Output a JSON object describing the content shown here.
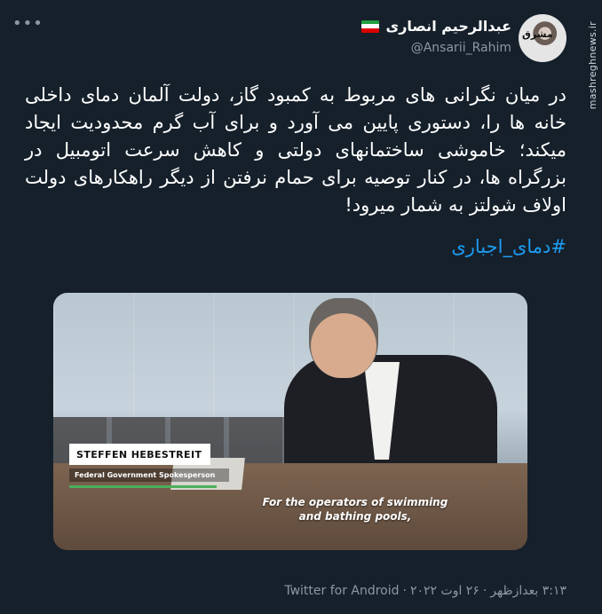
{
  "watermark": "mashreghnews.ir",
  "author": {
    "display_name": "عبدالرحیم انصاری",
    "handle": "@Ansarii_Rahim",
    "avatar_mark": "مشرق",
    "flag_colors": [
      "#239f40",
      "#ffffff",
      "#da0000"
    ]
  },
  "tweet": {
    "text": "در میان نگرانی های مربوط به کمبود گاز، دولت آلمان دمای داخلی خانه ها را، دستوری پایین می آورد و برای آب گرم محدودیت ایجاد میکند؛ خاموشی ساختمانهای دولتی و کاهش سرعت اتومبیل در بزرگراه ها، در کنار توصیه برای حمام نرفتن از دیگر راهکارهای دولت اولاف شولتز به شمار میرود!",
    "hashtag": "#دمای_اجباری"
  },
  "media": {
    "lower_third_name": "STEFFEN HEBESTREIT",
    "lower_third_title": "Federal Government Spokesperson",
    "caption_line1": "For the operators of swimming",
    "caption_line2": "and bathing pools,"
  },
  "meta": {
    "time": "۳:۱۳ بعدازظهر",
    "date": "۲۶ اوت ۲۰۲۲",
    "source": "Twitter for Android",
    "separator": "·"
  }
}
